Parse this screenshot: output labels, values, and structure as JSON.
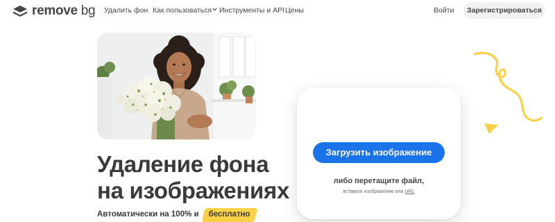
{
  "header": {
    "logo": {
      "text_bold": "remove",
      "text_light": "bg"
    },
    "nav": [
      {
        "label": "Удалить фон"
      },
      {
        "label": "Как пользоваться"
      },
      {
        "label": "Инструменты и API"
      },
      {
        "label": "Цены"
      }
    ],
    "login_label": "Войти",
    "signup_label": "Зарегистрироваться"
  },
  "hero": {
    "headline_line1": "Удаление фона",
    "headline_line2": "на изображениях",
    "subline_text": "Автоматически на 100% и",
    "subline_badge": "бесплатно"
  },
  "upload": {
    "button_label": "Загрузить изображение",
    "drop_text": "либо перетащите файл,",
    "paste_text": "вставьте изображение или",
    "paste_link": "URL"
  },
  "colors": {
    "accent_blue": "#1a73e8",
    "accent_yellow": "#f8d146",
    "text_dark": "#454545"
  },
  "icons": {
    "logo": "removebg-logo-icon",
    "nav_dropdown": "chevron-down-icon",
    "decor_squiggle": "squiggle-decoration",
    "decor_triangle": "triangle-decoration"
  }
}
